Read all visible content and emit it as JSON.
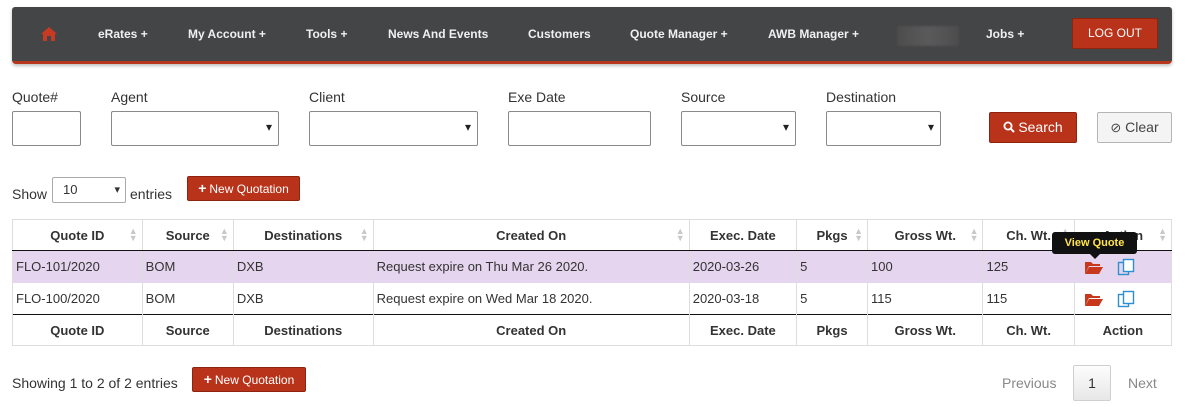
{
  "nav": {
    "items": [
      "eRates +",
      "My Account +",
      "Tools +",
      "News And Events",
      "Customers",
      "Quote Manager +",
      "AWB Manager +",
      "Jobs +"
    ],
    "logout": "LOG OUT",
    "home_icon": "home-icon",
    "accent": "#b8331a"
  },
  "filters": {
    "quote_label": "Quote#",
    "agent_label": "Agent",
    "client_label": "Client",
    "exe_date_label": "Exe Date",
    "source_label": "Source",
    "destination_label": "Destination",
    "search_button": "Search",
    "clear_button": "Clear"
  },
  "entries": {
    "show": "Show",
    "value": "10",
    "suffix": "entries",
    "new_quotation": "New Quotation"
  },
  "table": {
    "columns": [
      "Quote ID",
      "Source",
      "Destinations",
      "Created On",
      "Exec. Date",
      "Pkgs",
      "Gross Wt.",
      "Ch. Wt.",
      "Action"
    ],
    "rows": [
      [
        "FLO-101/2020",
        "BOM",
        "DXB",
        "Request expire on Thu Mar 26 2020.",
        "2020-03-26",
        "5",
        "100",
        "125"
      ],
      [
        "FLO-100/2020",
        "BOM",
        "DXB",
        "Request expire on Wed Mar 18 2020.",
        "2020-03-18",
        "5",
        "115",
        "115"
      ]
    ],
    "tooltip": "View Quote",
    "action_icons": [
      "folder-open-icon",
      "copy-icon"
    ]
  },
  "footer": {
    "showing": "Showing 1 to 2 of 2 entries",
    "new_quotation": "New Quotation",
    "previous": "Previous",
    "page": "1",
    "next": "Next"
  }
}
